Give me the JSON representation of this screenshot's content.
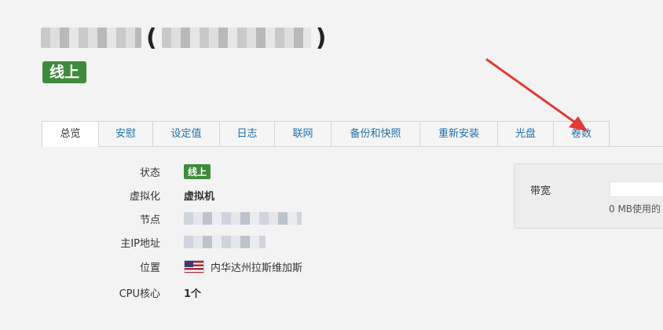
{
  "header": {
    "title_paren_open": "(",
    "title_paren_close": ")",
    "status_label": "线上"
  },
  "tabs": [
    {
      "label": "总览",
      "active": true
    },
    {
      "label": "安慰",
      "active": false
    },
    {
      "label": "设定值",
      "active": false
    },
    {
      "label": "日志",
      "active": false
    },
    {
      "label": "联网",
      "active": false
    },
    {
      "label": "备份和快照",
      "active": false
    },
    {
      "label": "重新安装",
      "active": false
    },
    {
      "label": "光盘",
      "active": false
    },
    {
      "label": "卷数",
      "active": false
    }
  ],
  "overview": {
    "status": {
      "label": "状态",
      "value": "线上"
    },
    "virtualization": {
      "label": "虚拟化",
      "value": "虚拟机"
    },
    "node": {
      "label": "节点"
    },
    "main_ip": {
      "label": "主IP地址"
    },
    "location": {
      "label": "位置",
      "value": "内华达州拉斯维加斯",
      "flag_icon": "us-flag-icon"
    },
    "cpu": {
      "label": "CPU核心",
      "value": "1个"
    }
  },
  "bandwidth": {
    "label": "带宽",
    "usage_text": "0 MB使用的"
  },
  "colors": {
    "status_green": "#3f8b3e",
    "link_blue": "#1f6fb0",
    "annotation_red": "#e53935"
  }
}
